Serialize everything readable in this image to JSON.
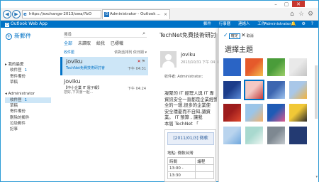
{
  "window": {
    "minimize": "–",
    "maximize": "▢",
    "close": "✕"
  },
  "browser": {
    "back": "◀",
    "forward": "▶",
    "address": "https://exchange-2013/owa/?bO",
    "address_controls": "🔒 ▾ C",
    "tab_title": "Administrator - Outlook ...",
    "tab_close": "×",
    "icons": [
      "home-icon",
      "star-icon",
      "gear-icon"
    ]
  },
  "owa": {
    "app_name": "Outlook Web App",
    "nav": [
      "郵件",
      "行事曆",
      "連絡人",
      "工作"
    ],
    "user": "Administrator ▾",
    "header_icons": "🔔 ⚙ ?"
  },
  "left": {
    "new_mail": "新郵件",
    "folders": [
      {
        "label": "▸ 我的最愛",
        "kind": "head"
      },
      {
        "label": "收件匣",
        "count": "1",
        "kind": "sub"
      },
      {
        "label": "寄件備份",
        "kind": "sub"
      },
      {
        "label": "草稿",
        "kind": "sub"
      },
      {
        "label": "",
        "kind": "spacer"
      },
      {
        "label": "◂ Administrator",
        "kind": "head"
      },
      {
        "label": "收件匣",
        "count": "1",
        "kind": "sub",
        "selected": true
      },
      {
        "label": "草稿",
        "kind": "sub"
      },
      {
        "label": "寄件備份",
        "kind": "sub"
      },
      {
        "label": "刪除的郵件",
        "kind": "sub"
      },
      {
        "label": "垃圾郵件",
        "kind": "sub"
      },
      {
        "label": "記事",
        "kind": "sub"
      }
    ]
  },
  "list": {
    "search_placeholder": "搜尋",
    "filters": [
      "全部",
      "未讀取",
      "給我",
      "已標幟"
    ],
    "section": "收件匣",
    "sort": "依對話排列 依日期 ▾",
    "messages": [
      {
        "from": "joviku",
        "subject": "TechNet免費技術研討會",
        "preview": "",
        "time": "下午 04:31",
        "selected": true,
        "actions": "✕ ⚑"
      },
      {
        "from": "joviku",
        "subject": "【中小企業 IT 電子報】",
        "preview": "您好,下次會一起...",
        "time": "下午 04:24",
        "selected": false,
        "actions": ""
      }
    ]
  },
  "reading": {
    "title": "TechNet免費技術研討會",
    "sender": "joviku",
    "date": "2013/10/31 下午 04:31",
    "to_label": "收件者:",
    "to_value": "Administrator;",
    "body": [
      "凝聚的 IT 經理人與 IT 專",
      "資訊安全一直都是企業經營",
      "全的一環,很多的企業使",
      "安全隱憂而不自知,讓資",
      "業。 IT 預算 , 讓我",
      "本屆 TechNet 「"
    ],
    "banner": "[2011/01/3] 微軟",
    "location_line": "地點: 微軟台灣",
    "table": [
      [
        "時間",
        "議程"
      ],
      [
        "13:00 -",
        ""
      ],
      [
        "13:30",
        ""
      ]
    ]
  },
  "theme_panel": {
    "ok": "確定",
    "cancel": "取消",
    "title": "選擇主題",
    "scroll_down": "▾",
    "tiles": [
      {
        "name": "theme-blue",
        "colors": [
          "#2a64c5",
          "#2a64c5"
        ]
      },
      {
        "name": "theme-flowers",
        "colors": [
          "#e55a2b",
          "#f6c04f"
        ]
      },
      {
        "name": "theme-leaves",
        "colors": [
          "#4a9c3a",
          "#9ed06b"
        ]
      },
      {
        "name": "theme-dots",
        "colors": [
          "#e9e9e9",
          "#c4c4c4"
        ]
      },
      {
        "name": "theme-pixel",
        "colors": [
          "#1c3c8a",
          "#5b8ad6"
        ]
      },
      {
        "name": "theme-petals",
        "colors": [
          "#f3c9c4",
          "#c43c3c"
        ]
      },
      {
        "name": "theme-circuit",
        "colors": [
          "#3d66b0",
          "#9ec3ef"
        ]
      },
      {
        "name": "theme-cartoon",
        "colors": [
          "#a9c7e8",
          "#f2b33d"
        ]
      },
      {
        "name": "theme-red",
        "colors": [
          "#9d1c1c",
          "#e04a2f"
        ]
      },
      {
        "name": "theme-stripes",
        "colors": [
          "#9bc5e8",
          "#f3b26b"
        ]
      },
      {
        "name": "theme-pink-blue",
        "colors": [
          "#1f5bb5",
          "#e05a8c"
        ]
      },
      {
        "name": "theme-yellow",
        "colors": [
          "#f1c836",
          "#2b2b2b"
        ]
      },
      {
        "name": "theme-sky",
        "colors": [
          "#b9d4ee",
          "#6fa7dd"
        ]
      },
      {
        "name": "theme-leaf-light",
        "colors": [
          "#a9d9cf",
          "#eef6f2"
        ]
      },
      {
        "name": "theme-gray",
        "colors": [
          "#7e8891",
          "#c3c9ce"
        ]
      },
      {
        "name": "theme-navy",
        "colors": [
          "#233a72",
          "#233a72"
        ]
      }
    ],
    "selected_tile": 5
  }
}
